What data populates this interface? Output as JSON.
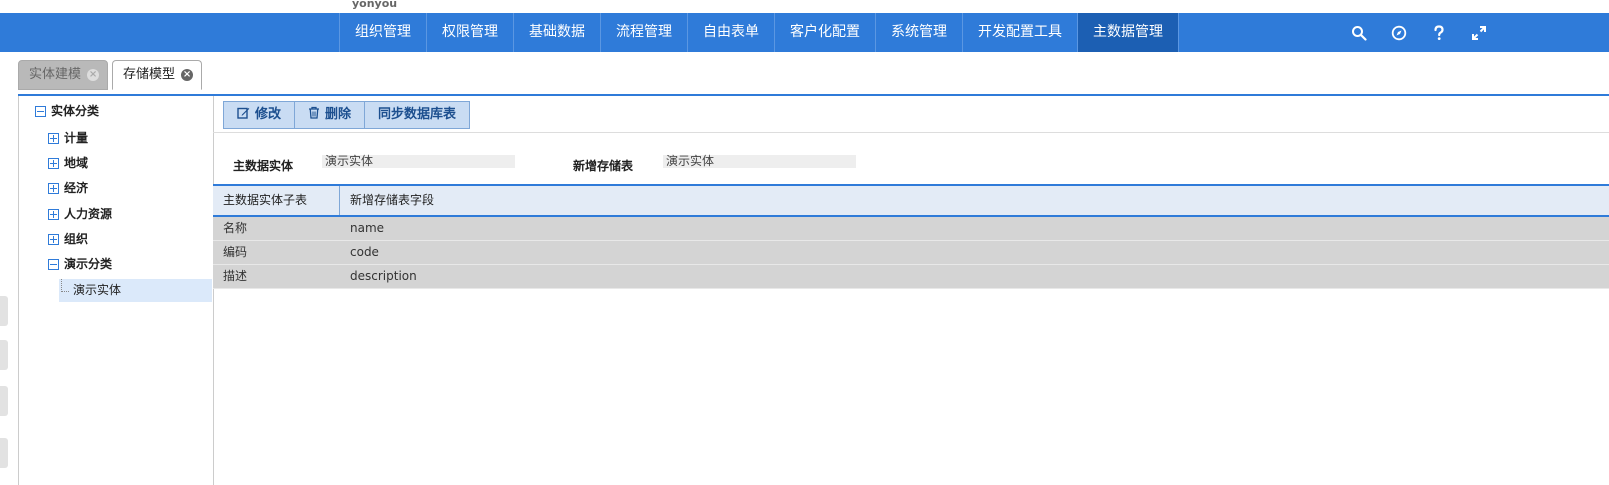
{
  "brand": "yonyou",
  "top_nav": [
    {
      "label": "组织管理"
    },
    {
      "label": "权限管理"
    },
    {
      "label": "基础数据"
    },
    {
      "label": "流程管理"
    },
    {
      "label": "自由表单"
    },
    {
      "label": "客户化配置"
    },
    {
      "label": "系统管理"
    },
    {
      "label": "开发配置工具"
    },
    {
      "label": "主数据管理"
    }
  ],
  "active_nav": "主数据管理",
  "top_icons": [
    "search-icon",
    "compass-icon",
    "help-icon",
    "fullscreen-icon"
  ],
  "tabs": [
    {
      "label": "实体建模",
      "active": false
    },
    {
      "label": "存储模型",
      "active": true
    }
  ],
  "tree": {
    "root": "实体分类",
    "children": [
      "计量",
      "地域",
      "经济",
      "人力资源",
      "组织",
      "演示分类"
    ],
    "leaf": "演示实体"
  },
  "toolbar": {
    "edit": "修改",
    "delete": "删除",
    "sync": "同步数据库表"
  },
  "form": {
    "entity_label": "主数据实体",
    "entity_value": "演示实体",
    "table_label": "新增存储表",
    "table_value": "演示实体"
  },
  "grid": {
    "headers": [
      "主数据实体子表",
      "新增存储表字段"
    ],
    "rows": [
      [
        "名称",
        "name"
      ],
      [
        "编码",
        "code"
      ],
      [
        "描述",
        "description"
      ]
    ]
  },
  "colors": {
    "topbar": "#2f7bd9",
    "active_nav": "#1c5fb3",
    "selected_leaf": "#dbe9fa",
    "grid_row": "#d4d4d4"
  }
}
